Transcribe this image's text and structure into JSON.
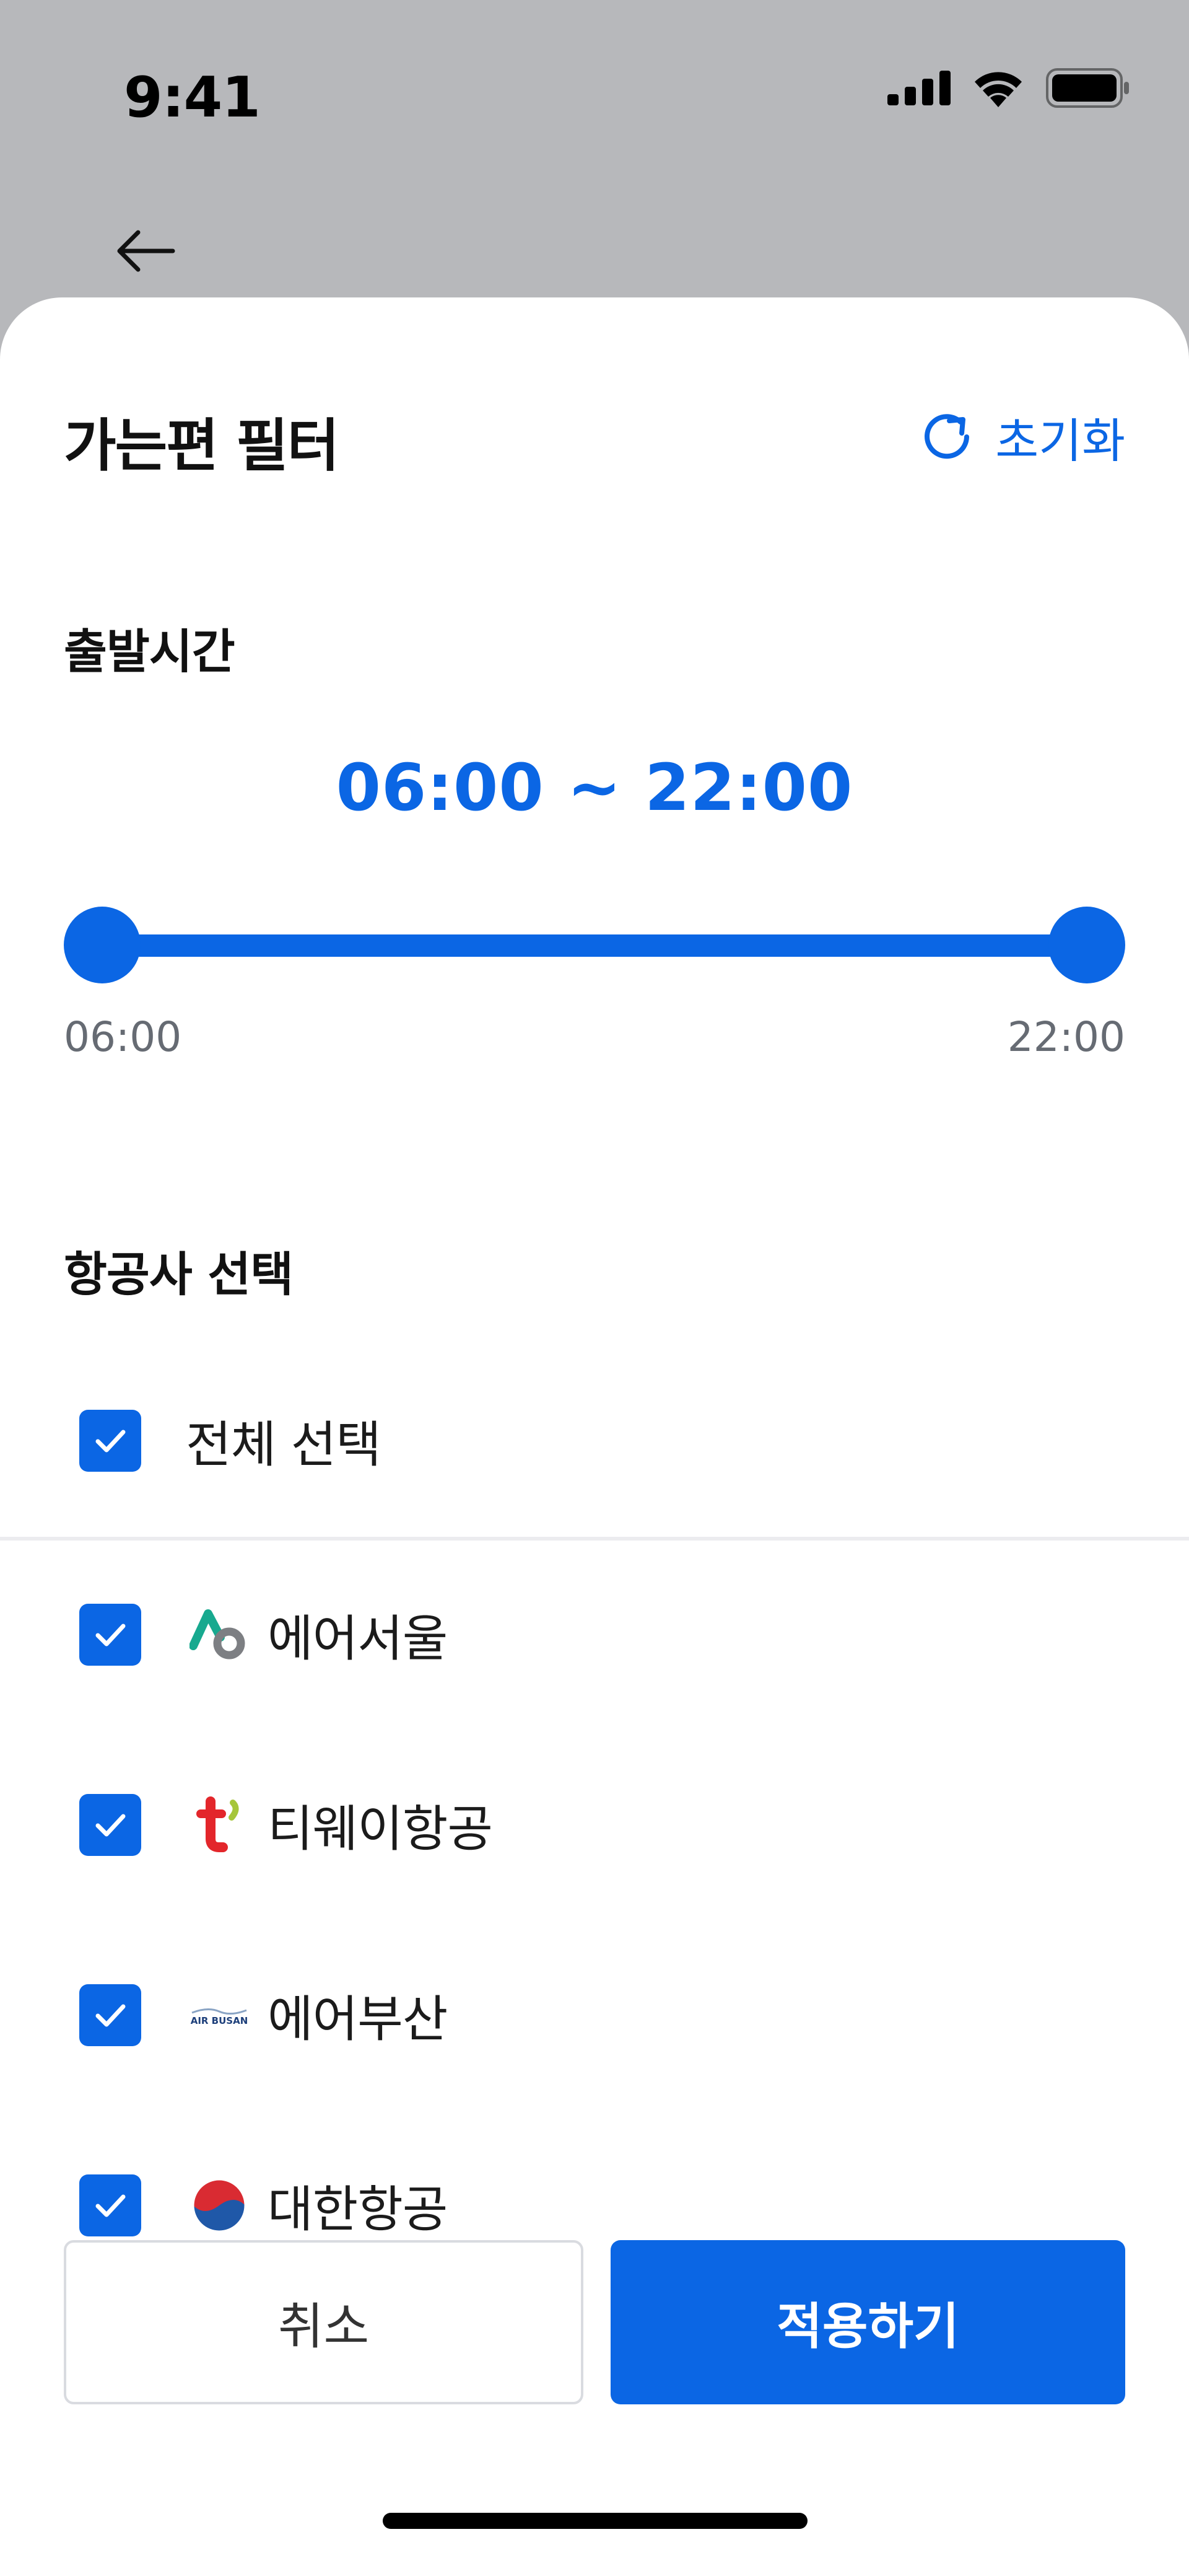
{
  "status_bar": {
    "time": "9:41"
  },
  "header": {
    "back_icon": "arrow-left-icon"
  },
  "sheet": {
    "title": "가는편 필터",
    "reset_label": "초기화",
    "reset_icon": "refresh-icon"
  },
  "departure_time": {
    "section_title": "출발시간",
    "range_text": "06:00 ~ 22:00",
    "min_label": "06:00",
    "max_label": "22:00",
    "selected_start_fraction": 0,
    "selected_end_fraction": 1
  },
  "airlines": {
    "section_title": "항공사 선택",
    "select_all_label": "전체 선택",
    "select_all_checked": true,
    "items": [
      {
        "label": "에어서울",
        "checked": true,
        "icon": "air-seoul-logo-icon"
      },
      {
        "label": "티웨이항공",
        "checked": true,
        "icon": "tway-logo-icon"
      },
      {
        "label": "에어부산",
        "checked": true,
        "icon": "air-busan-logo-icon"
      },
      {
        "label": "대한항공",
        "checked": true,
        "icon": "korean-air-logo-icon"
      }
    ]
  },
  "logo_text": {
    "air_busan": "AIR BUSAN"
  },
  "footer": {
    "cancel_label": "취소",
    "apply_label": "적용하기"
  },
  "colors": {
    "accent": "#0b66e4",
    "overlay": "#b7b8bb"
  }
}
